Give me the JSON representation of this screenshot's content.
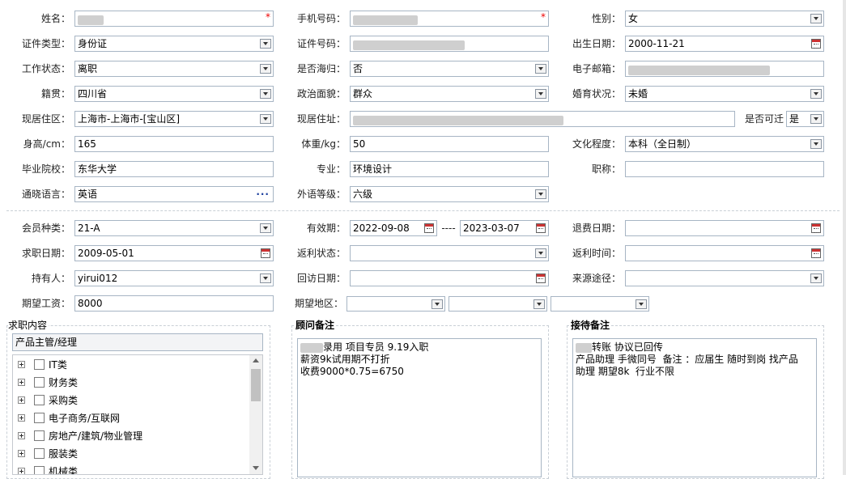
{
  "form": {
    "name": {
      "label": "姓名：",
      "value": "",
      "required": "*"
    },
    "phone": {
      "label": "手机号码：",
      "value": "",
      "required": "*"
    },
    "gender": {
      "label": "性别：",
      "value": "女"
    },
    "id_type": {
      "label": "证件类型：",
      "value": "身份证"
    },
    "id_number": {
      "label": "证件号码：",
      "value": ""
    },
    "birth": {
      "label": "出生日期：",
      "value": "2000-11-21"
    },
    "work_status": {
      "label": "工作状态：",
      "value": "离职"
    },
    "returnee": {
      "label": "是否海归：",
      "value": "否"
    },
    "email": {
      "label": "电子邮箱：",
      "value": ""
    },
    "hometown": {
      "label": "籍贯：",
      "value": "四川省"
    },
    "political": {
      "label": "政治面貌：",
      "value": "群众"
    },
    "marital": {
      "label": "婚育状况：",
      "value": "未婚"
    },
    "district": {
      "label": "现居住区：",
      "value": "上海市-上海市-[宝山区]"
    },
    "address": {
      "label": "现居住址：",
      "value": ""
    },
    "migrate": {
      "label": "是否可迁",
      "value": "是"
    },
    "height": {
      "label": "身高/cm：",
      "value": "165"
    },
    "weight": {
      "label": "体重/kg：",
      "value": "50"
    },
    "education": {
      "label": "文化程度：",
      "value": "本科（全日制）"
    },
    "school": {
      "label": "毕业院校：",
      "value": "东华大学"
    },
    "major": {
      "label": "专业：",
      "value": "环境设计"
    },
    "title": {
      "label": "职称：",
      "value": ""
    },
    "language": {
      "label": "通晓语言：",
      "value": "英语"
    },
    "lang_level": {
      "label": "外语等级：",
      "value": "六级"
    },
    "member_type": {
      "label": "会员种类：",
      "value": "21-A"
    },
    "valid": {
      "label": "有效期：",
      "from": "2022-09-08",
      "sep": "----",
      "to": "2023-03-07"
    },
    "refund_date": {
      "label": "退费日期：",
      "value": ""
    },
    "job_date": {
      "label": "求职日期：",
      "value": "2009-05-01"
    },
    "rebate_status": {
      "label": "返利状态：",
      "value": ""
    },
    "rebate_time": {
      "label": "返利时间：",
      "value": ""
    },
    "holder": {
      "label": "持有人：",
      "value": "yirui012"
    },
    "visit_date": {
      "label": "回访日期：",
      "value": ""
    },
    "source": {
      "label": "来源途径：",
      "value": ""
    },
    "salary": {
      "label": "期望工资：",
      "value": "8000"
    },
    "region": {
      "label": "期望地区：",
      "v1": "",
      "v2": "",
      "v3": ""
    }
  },
  "job_content": {
    "title": "求职内容",
    "selected": "产品主管/经理",
    "items": [
      "IT类",
      "财务类",
      "采购类",
      "电子商务/互联网",
      "房地产/建筑/物业管理",
      "服装类",
      "机械类"
    ]
  },
  "advisor_notes": {
    "title": "顾问备注",
    "text": "录用 项目专员 9.19入职\n薪资9k试用期不打折\n收费9000*0.75=6750"
  },
  "reception_notes": {
    "title": "接待备注",
    "text": "转账 协议已回传\n产品助理 手微同号  备注 ：应届生 随时到岗 找产品\n助理 期望8k  行业不限"
  }
}
